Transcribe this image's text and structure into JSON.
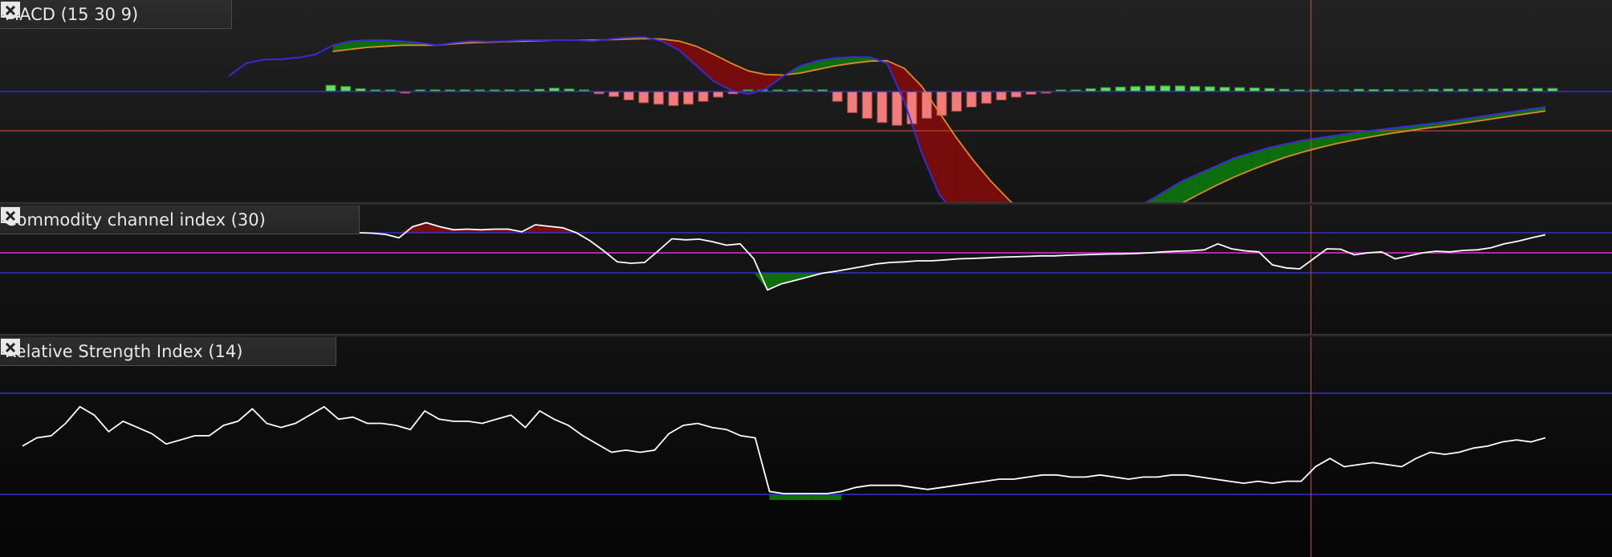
{
  "panels": [
    {
      "id": "macd",
      "title": "MACD (15 30 9)"
    },
    {
      "id": "cci",
      "title": "Commodity channel index (30)"
    },
    {
      "id": "rsi",
      "title": "Relative Strength Index (14)"
    }
  ],
  "icons": {
    "settings": "wrench-icon",
    "window": "window-icon",
    "close": "close-circle-icon"
  },
  "colors": {
    "background": "#161616",
    "macd_line": "#3a2ad6",
    "signal_line": "#e0892e",
    "hist_up": "#5fe05f",
    "hist_down": "#f07c7c",
    "fill_bull": "#0c6e0c",
    "fill_bear": "#760c0c",
    "cci_line": "#ffffff",
    "guide": "#3030d0",
    "zero_cci": "#c030c0",
    "crosshair": "#b04a30"
  },
  "chart_data": [
    {
      "type": "line",
      "panel": "MACD (15 30 9)",
      "series": [
        {
          "values": [
            0.3,
            0.55,
            0.62,
            0.63,
            0.66,
            0.72,
            0.9,
            0.98,
            1.0,
            1.0,
            0.98,
            0.95,
            0.9,
            0.95,
            0.98,
            0.97,
            0.98,
            1.0,
            1.0,
            1.0,
            1.0,
            0.98,
            1.02,
            1.05,
            1.06,
            0.98,
            0.8,
            0.5,
            0.2,
            0.02,
            -0.05,
            0.05,
            0.3,
            0.5,
            0.6,
            0.65,
            0.67,
            0.67,
            0.55,
            -0.2,
            -1.2,
            -2.0,
            -2.4,
            -2.6,
            -2.75,
            -2.85,
            -2.9,
            -2.9,
            -2.87,
            -2.8,
            -2.7,
            -2.55,
            -2.35,
            -2.15,
            -1.95,
            -1.75,
            -1.6,
            -1.45,
            -1.3,
            -1.2,
            -1.1,
            -1.02,
            -0.95,
            -0.9,
            -0.85,
            -0.8,
            -0.76,
            -0.72,
            -0.68,
            -0.64,
            -0.6,
            -0.55,
            -0.5,
            -0.45,
            -0.4,
            -0.35,
            -0.3
          ]
        },
        {
          "values": [
            null,
            null,
            null,
            null,
            null,
            null,
            0.78,
            0.82,
            0.86,
            0.88,
            0.9,
            0.9,
            0.9,
            0.93,
            0.95,
            0.96,
            0.97,
            0.98,
            0.99,
            1.0,
            1.0,
            1.0,
            1.01,
            1.02,
            1.03,
            1.02,
            0.98,
            0.88,
            0.72,
            0.55,
            0.4,
            0.33,
            0.32,
            0.36,
            0.43,
            0.5,
            0.55,
            0.59,
            0.6,
            0.45,
            0.1,
            -0.4,
            -0.9,
            -1.35,
            -1.75,
            -2.1,
            -2.4,
            -2.6,
            -2.75,
            -2.83,
            -2.85,
            -2.8,
            -2.7,
            -2.55,
            -2.37,
            -2.18,
            -2.0,
            -1.83,
            -1.67,
            -1.53,
            -1.4,
            -1.28,
            -1.18,
            -1.09,
            -1.01,
            -0.94,
            -0.88,
            -0.82,
            -0.77,
            -0.72,
            -0.68,
            -0.63,
            -0.58,
            -0.53,
            -0.48,
            -0.43,
            -0.38
          ]
        }
      ],
      "histogram": [
        0.22,
        0.18,
        0.1,
        0.05,
        0.02,
        -0.05,
        0.06,
        0.06,
        0.05,
        0.06,
        0.05,
        0.04,
        0.06,
        0.05,
        0.08,
        0.12,
        0.09,
        0.0,
        -0.08,
        -0.18,
        -0.3,
        -0.4,
        -0.45,
        -0.5,
        -0.45,
        -0.35,
        -0.2,
        -0.08,
        0.0,
        0.06,
        0.04,
        0.04,
        0.05,
        0.06,
        -0.35,
        -0.75,
        -0.95,
        -1.1,
        -1.2,
        -1.15,
        -0.95,
        -0.85,
        -0.7,
        -0.55,
        -0.42,
        -0.3,
        -0.2,
        -0.1,
        -0.04,
        0.0,
        0.05,
        0.1,
        0.14,
        0.16,
        0.18,
        0.2,
        0.2,
        0.2,
        0.18,
        0.17,
        0.15,
        0.14,
        0.13,
        0.11,
        0.08,
        0.05,
        0.04,
        0.05,
        0.06,
        0.08,
        0.07,
        0.07,
        0.06,
        0.05,
        0.08,
        0.09,
        0.08,
        0.09,
        0.09,
        0.1,
        0.1,
        0.11,
        0.11
      ]
    },
    {
      "type": "line",
      "panel": "Commodity channel index (30)",
      "series": [
        {
          "values": [
            120,
            105,
            100,
            98,
            92,
            75,
            130,
            150,
            130,
            115,
            118,
            115,
            118,
            118,
            105,
            140,
            132,
            125,
            100,
            60,
            10,
            -45,
            -52,
            -48,
            10,
            70,
            65,
            68,
            55,
            38,
            45,
            -30,
            -185,
            -155,
            -138,
            -120,
            -102,
            -92,
            -80,
            -68,
            -55,
            -48,
            -45,
            -40,
            -40,
            -35,
            -30,
            -28,
            -25,
            -22,
            -20,
            -18,
            -15,
            -15,
            -12,
            -10,
            -8,
            -6,
            -5,
            -3,
            0,
            5,
            8,
            10,
            15,
            45,
            20,
            10,
            5,
            -60,
            -75,
            -80,
            -30,
            20,
            18,
            -10,
            0,
            5,
            -30,
            -15,
            0,
            8,
            5,
            12,
            15,
            25,
            45,
            58,
            75,
            90
          ]
        }
      ]
    },
    {
      "type": "line",
      "panel": "Relative Strength Index (14)",
      "series": [
        {
          "values": [
            53,
            57,
            58,
            64,
            72,
            68,
            60,
            65,
            62,
            59,
            54,
            56,
            58,
            58,
            63,
            65,
            71,
            64,
            62,
            64,
            68,
            72,
            66,
            67,
            64,
            64,
            63,
            61,
            70,
            66,
            65,
            65,
            64,
            66,
            68,
            62,
            70,
            66,
            63,
            58,
            54,
            50,
            51,
            50,
            51,
            59,
            63,
            64,
            62,
            61,
            58,
            57,
            31,
            30,
            30,
            30,
            30,
            31,
            33,
            34,
            34,
            34,
            33,
            32,
            33,
            34,
            35,
            36,
            37,
            37,
            38,
            39,
            39,
            38,
            38,
            39,
            38,
            37,
            38,
            38,
            39,
            39,
            38,
            37,
            36,
            35,
            36,
            35,
            36,
            36,
            43,
            47,
            43,
            44,
            45,
            44,
            43,
            47,
            50,
            49,
            50,
            52,
            53,
            55,
            56,
            55,
            57
          ]
        }
      ]
    }
  ]
}
